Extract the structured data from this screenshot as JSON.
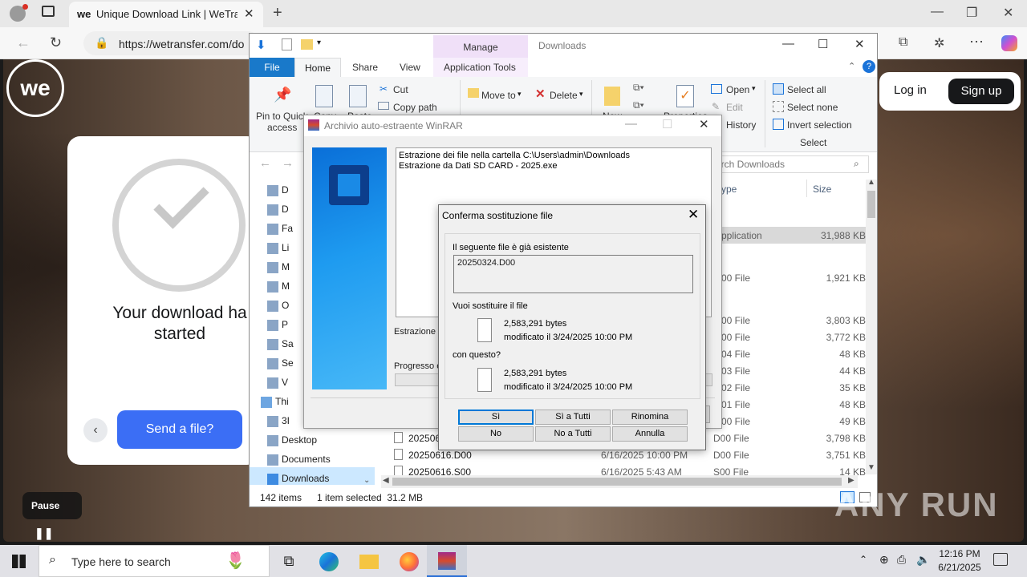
{
  "browser": {
    "tab_title": "Unique Download Link | WeTransf",
    "tab_favicon": "we",
    "url": "https://wetransfer.com/do"
  },
  "webpage": {
    "logo": "we",
    "download_status": "Your download ha started",
    "download_line1": "Your download ha",
    "download_line2": "started",
    "send_button": "Send a file?",
    "pause_label": "Pause",
    "login": "Log in",
    "signup": "Sign up"
  },
  "explorer": {
    "manage_tab": "Manage",
    "title": "Downloads",
    "tabs": [
      "File",
      "Home",
      "Share",
      "View",
      "Application Tools"
    ],
    "ribbon": {
      "pin_quick_access": "Pin to Quick",
      "pin_quick_access2": "access",
      "copy": "Copy",
      "paste": "Paste",
      "cut": "Cut",
      "copy_path": "Copy path",
      "move_to": "Move to",
      "delete": "Delete",
      "new": "New",
      "properties": "Properties",
      "open": "Open",
      "edit": "Edit",
      "history": "History",
      "select_all": "Select all",
      "select_none": "Select none",
      "invert_selection": "Invert selection",
      "select_group": "Select"
    },
    "search_placeholder": "arch Downloads",
    "columns": {
      "type": "ype",
      "size": "Size"
    },
    "nav_items": [
      "D",
      "D",
      "Fa",
      "Li",
      "M",
      "M",
      "O",
      "P",
      "Sa",
      "Se",
      "V",
      "Thi",
      "3I",
      "Desktop",
      "Documents",
      "Downloads"
    ],
    "files": [
      {
        "name": "",
        "date": "",
        "type": "pplication",
        "size": "31,988 KB",
        "selected": true
      },
      {
        "name": "",
        "date": "",
        "type": "00 File",
        "size": "1,921 KB"
      },
      {
        "name": "",
        "date": "",
        "type": "00 File",
        "size": "3,803 KB"
      },
      {
        "name": "",
        "date": "",
        "type": "00 File",
        "size": "3,772 KB"
      },
      {
        "name": "",
        "date": "",
        "type": "04 File",
        "size": "48 KB"
      },
      {
        "name": "",
        "date": "",
        "type": "03 File",
        "size": "44 KB"
      },
      {
        "name": "",
        "date": "",
        "type": "02 File",
        "size": "35 KB"
      },
      {
        "name": "",
        "date": "",
        "type": "01 File",
        "size": "48 KB"
      },
      {
        "name": "",
        "date": "",
        "type": "00 File",
        "size": "49 KB"
      },
      {
        "name": "2025061",
        "date": "6/16/2025 10:00 PM",
        "type": "D00 File",
        "size": "3,798 KB"
      },
      {
        "name": "20250616.D00",
        "date": "6/16/2025 10:00 PM",
        "type": "D00 File",
        "size": "3,751 KB"
      },
      {
        "name": "20250616.S00",
        "date": "6/16/2025 5:43 AM",
        "type": "S00 File",
        "size": "14 KB"
      }
    ],
    "status_items": "142 items",
    "status_selected": "1 item selected  31.2 MB"
  },
  "winrar": {
    "title": "Archivio auto-estraente WinRAR",
    "log_line1": "Estrazione dei file nella cartella C:\\Users\\admin\\Downloads",
    "log_line2": "Estrazione da Dati SD CARD - 2025.exe",
    "extract_label": "Estrazione d",
    "progress_label": "Progresso e"
  },
  "confirm": {
    "title": "Conferma sostituzione file",
    "exists_label": "Il seguente file è già esistente",
    "filename": "20250324.D00",
    "replace_label": "Vuoi sostituire il file",
    "old_size": "2,583,291 bytes",
    "old_modified": "modificato il 3/24/2025 10:00 PM",
    "with_label": "con questo?",
    "new_size": "2,583,291 bytes",
    "new_modified": "modificato il 3/24/2025 10:00 PM",
    "buttons": [
      "Sì",
      "Sì a Tutti",
      "Rinomina",
      "No",
      "No a Tutti",
      "Annulla"
    ]
  },
  "taskbar": {
    "search_placeholder": "Type here to search",
    "time": "12:16 PM",
    "date": "6/21/2025"
  },
  "watermark": "ANY RUN"
}
